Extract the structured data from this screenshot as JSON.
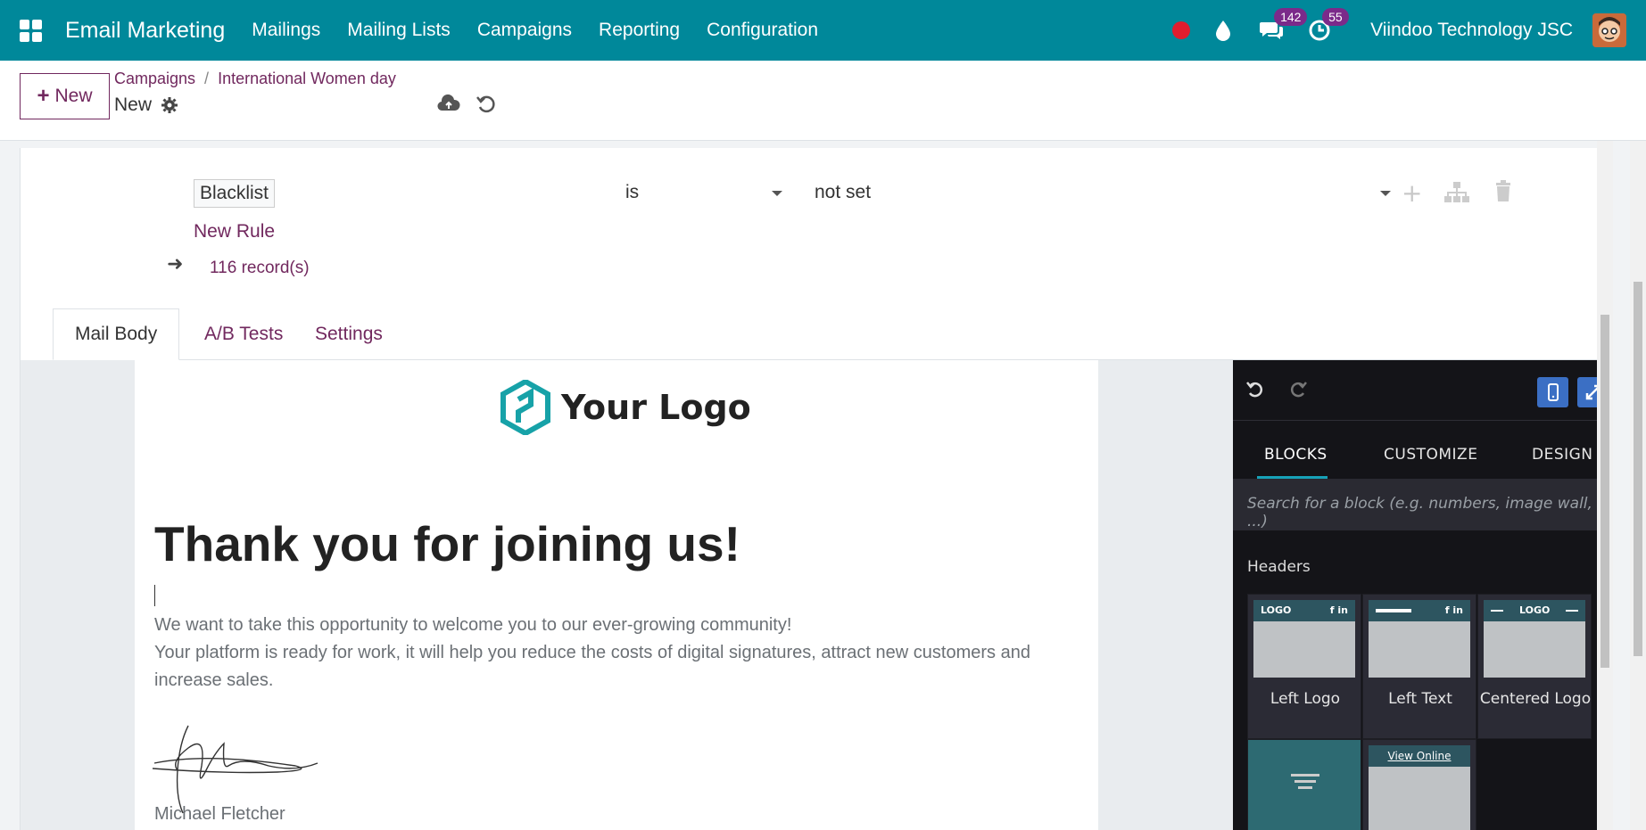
{
  "topbar": {
    "app_name": "Email Marketing",
    "menu": [
      "Mailings",
      "Mailing Lists",
      "Campaigns",
      "Reporting",
      "Configuration"
    ],
    "messages_count": "142",
    "activities_count": "55",
    "company": "Viindoo Technology JSC"
  },
  "control": {
    "new_label": "New",
    "breadcrumb_root": "Campaigns",
    "breadcrumb_current": "International Women day",
    "record_name": "New"
  },
  "domain_rule": {
    "field": "Blacklist",
    "operator": "is",
    "value": "not set",
    "new_rule_label": "New Rule",
    "record_count": "116 record(s)"
  },
  "tabs": [
    "Mail Body",
    "A/B Tests",
    "Settings"
  ],
  "mail": {
    "logo_text": "Your Logo",
    "title": "Thank you for joining us!",
    "paragraph1": "We want to take this opportunity to welcome you to our ever-growing community!",
    "paragraph2": "Your platform is ready for work, it will help you reduce the costs of digital signatures, attract new customers and increase sales.",
    "signature_name": "Michael Fletcher"
  },
  "snippets": {
    "tabs": [
      "BLOCKS",
      "CUSTOMIZE",
      "DESIGN"
    ],
    "search_placeholder": "Search for a block (e.g. numbers, image wall, ...)",
    "category": "Headers",
    "blocks": [
      "Left Logo",
      "Left Text",
      "Centered Logo"
    ],
    "thumb_logo": "LOGO",
    "thumb_social": "f in",
    "thumb_view_online": "View Online"
  },
  "colors": {
    "topbar": "#00889a",
    "accent": "#71285e",
    "editor_panel": "#141418",
    "badge": "#7b2a8a"
  }
}
